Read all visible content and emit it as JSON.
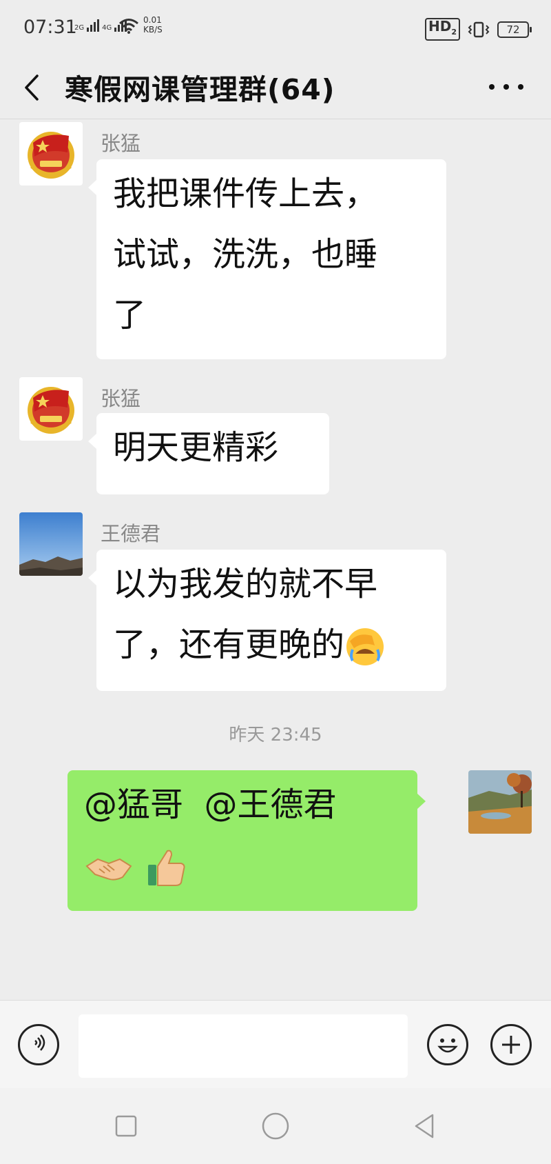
{
  "status_bar": {
    "time": "07:31",
    "net1": "2G",
    "net2": "4G",
    "speed_value": "0.01",
    "speed_unit": "KB/S",
    "hd_label": "HD",
    "hd_sub": "2",
    "battery": "72",
    "icons": [
      "signal-icon",
      "wifi-icon",
      "hd-voice-icon",
      "vibrate-icon",
      "battery-icon"
    ]
  },
  "header": {
    "title": "寒假网课管理群(64)",
    "back_icon": "chevron-left-icon",
    "more_icon": "more-dots-icon"
  },
  "messages": [
    {
      "sender": "张猛",
      "text": "我把课件传上去，试试，洗洗，也睡了",
      "lines": [
        "我把课件传上去，",
        "试试，洗洗，也睡",
        "了"
      ],
      "avatar": "youth-league-badge"
    },
    {
      "sender": "张猛",
      "text": "明天更精彩",
      "lines": [
        "明天更精彩"
      ],
      "avatar": "youth-league-badge"
    },
    {
      "sender": "王德君",
      "text": "以为我发的就不早了，还有更晚的",
      "lines": [
        "以为我发的就不早",
        "了，还有更晚的"
      ],
      "emoji": "facepalm-emoji",
      "avatar": "blue-sky-mountain-photo"
    }
  ],
  "timestamp": "昨天 23:45",
  "my_message": {
    "text": "@猛哥  @王德君",
    "emojis": [
      "handshake-emoji",
      "thumbs-up-emoji"
    ],
    "avatar": "autumn-landscape-photo"
  },
  "input_bar": {
    "voice_icon": "voice-icon",
    "emoji_icon": "smiley-icon",
    "plus_icon": "plus-icon",
    "input_value": ""
  },
  "nav_bar": {
    "icons": [
      "recents-square-icon",
      "home-circle-icon",
      "back-triangle-icon"
    ]
  },
  "colors": {
    "background": "#ededed",
    "my_bubble": "#95ec69",
    "other_bubble": "#ffffff",
    "sender_name": "#888888"
  }
}
